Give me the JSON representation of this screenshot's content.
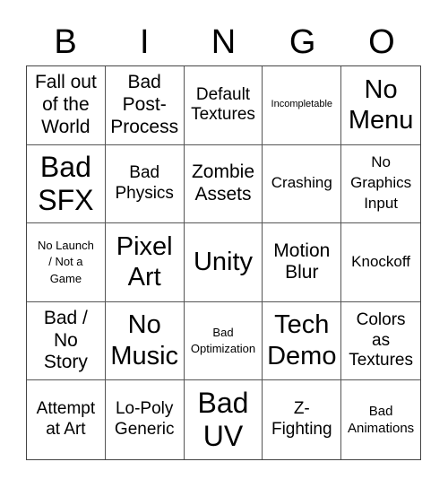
{
  "header": {
    "letters": [
      "B",
      "I",
      "N",
      "G",
      "O"
    ]
  },
  "cells": [
    {
      "text": "Fall out of the World"
    },
    {
      "text": "Bad Post-Process"
    },
    {
      "text": "Default Textures"
    },
    {
      "text": "Incompletable"
    },
    {
      "text": "No Menu"
    },
    {
      "text": "Bad SFX"
    },
    {
      "text": "Bad Physics"
    },
    {
      "text": "Zombie Assets"
    },
    {
      "text": "Crashing"
    },
    {
      "text": "No Graphics Input"
    },
    {
      "text": "No Launch / Not a Game"
    },
    {
      "text": "Pixel Art"
    },
    {
      "text": "Unity"
    },
    {
      "text": "Motion Blur"
    },
    {
      "text": "Knockoff"
    },
    {
      "text": "Bad / No Story"
    },
    {
      "text": "No Music"
    },
    {
      "text": "Bad Optimization"
    },
    {
      "text": "Tech Demo"
    },
    {
      "text": "Colors as Textures"
    },
    {
      "text": "Attempt at Art"
    },
    {
      "text": "Lo-Poly Generic"
    },
    {
      "text": "Bad UV"
    },
    {
      "text": "Z-Fighting"
    },
    {
      "text": "Bad Animations"
    }
  ]
}
